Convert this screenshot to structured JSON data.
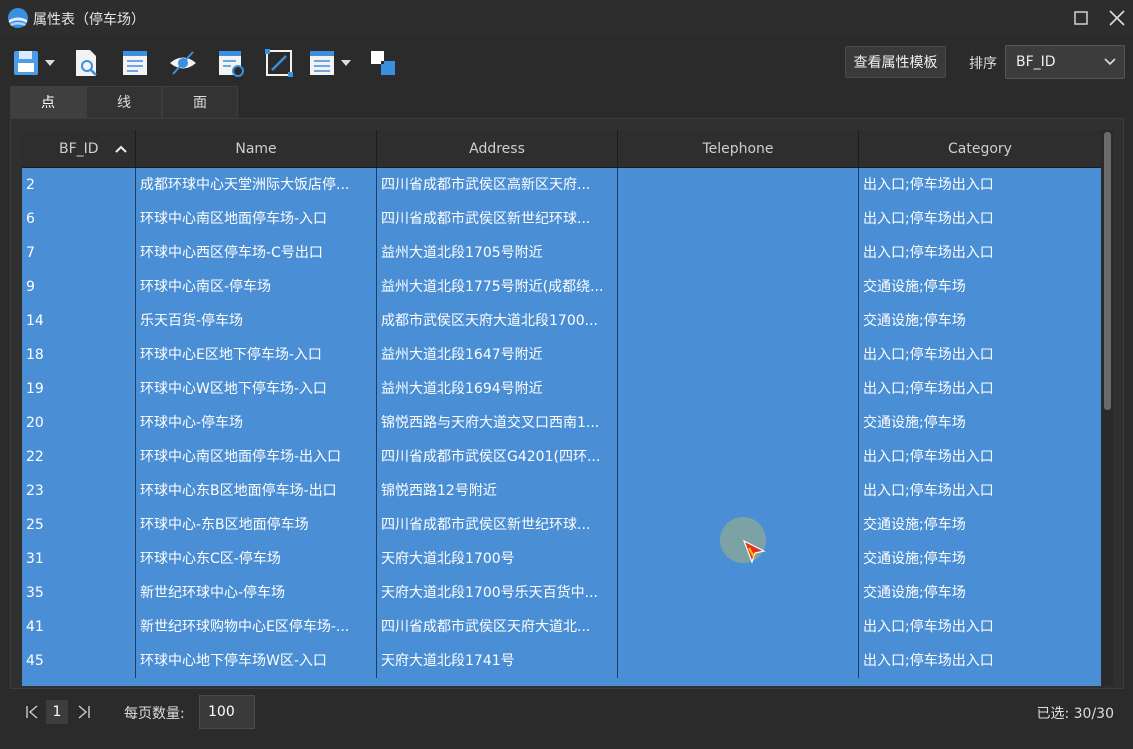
{
  "window": {
    "title": "属性表（停车场）"
  },
  "toolbar": {
    "template_button": "查看属性模板",
    "sort_label": "排序",
    "sort_value": "BF_ID"
  },
  "tabs": [
    "点",
    "线",
    "面"
  ],
  "table": {
    "columns": [
      "BF_ID",
      "Name",
      "Address",
      "Telephone",
      "Category"
    ],
    "rows": [
      [
        "2",
        "成都环球中心天堂洲际大饭店停...",
        "四川省成都市武侯区高新区天府...",
        "",
        "出入口;停车场出入口"
      ],
      [
        "6",
        "环球中心南区地面停车场-入口",
        "四川省成都市武侯区新世纪环球...",
        "",
        "出入口;停车场出入口"
      ],
      [
        "7",
        "环球中心西区停车场-C号出口",
        "益州大道北段1705号附近",
        "",
        "出入口;停车场出入口"
      ],
      [
        "9",
        "环球中心南区-停车场",
        "益州大道北段1775号附近(成都绕...",
        "",
        "交通设施;停车场"
      ],
      [
        "14",
        "乐天百货-停车场",
        "成都市武侯区天府大道北段1700...",
        "",
        "交通设施;停车场"
      ],
      [
        "18",
        "环球中心E区地下停车场-入口",
        "益州大道北段1647号附近",
        "",
        "出入口;停车场出入口"
      ],
      [
        "19",
        "环球中心W区地下停车场-入口",
        "益州大道北段1694号附近",
        "",
        "出入口;停车场出入口"
      ],
      [
        "20",
        "环球中心-停车场",
        "锦悦西路与天府大道交叉口西南1...",
        "",
        "交通设施;停车场"
      ],
      [
        "22",
        "环球中心南区地面停车场-出入口",
        "四川省成都市武侯区G4201(四环...",
        "",
        "出入口;停车场出入口"
      ],
      [
        "23",
        "环球中心东B区地面停车场-出口",
        "锦悦西路12号附近",
        "",
        "出入口;停车场出入口"
      ],
      [
        "25",
        "环球中心-东B区地面停车场",
        "四川省成都市武侯区新世纪环球...",
        "",
        "交通设施;停车场"
      ],
      [
        "31",
        "环球中心东C区-停车场",
        "天府大道北段1700号",
        "",
        "交通设施;停车场"
      ],
      [
        "35",
        "新世纪环球中心-停车场",
        "天府大道北段1700号乐天百货中...",
        "",
        "交通设施;停车场"
      ],
      [
        "41",
        "新世纪环球购物中心E区停车场-...",
        "四川省成都市武侯区天府大道北...",
        "",
        "出入口;停车场出入口"
      ],
      [
        "45",
        "环球中心地下停车场W区-入口",
        "天府大道北段1741号",
        "",
        "出入口;停车场出入口"
      ]
    ]
  },
  "footer": {
    "page": "1",
    "page_size_label": "每页数量:",
    "page_size": "100",
    "selected": "已选: 30/30"
  },
  "colors": {
    "selection": "#4a8fd6",
    "background": "#2b2b2b"
  }
}
